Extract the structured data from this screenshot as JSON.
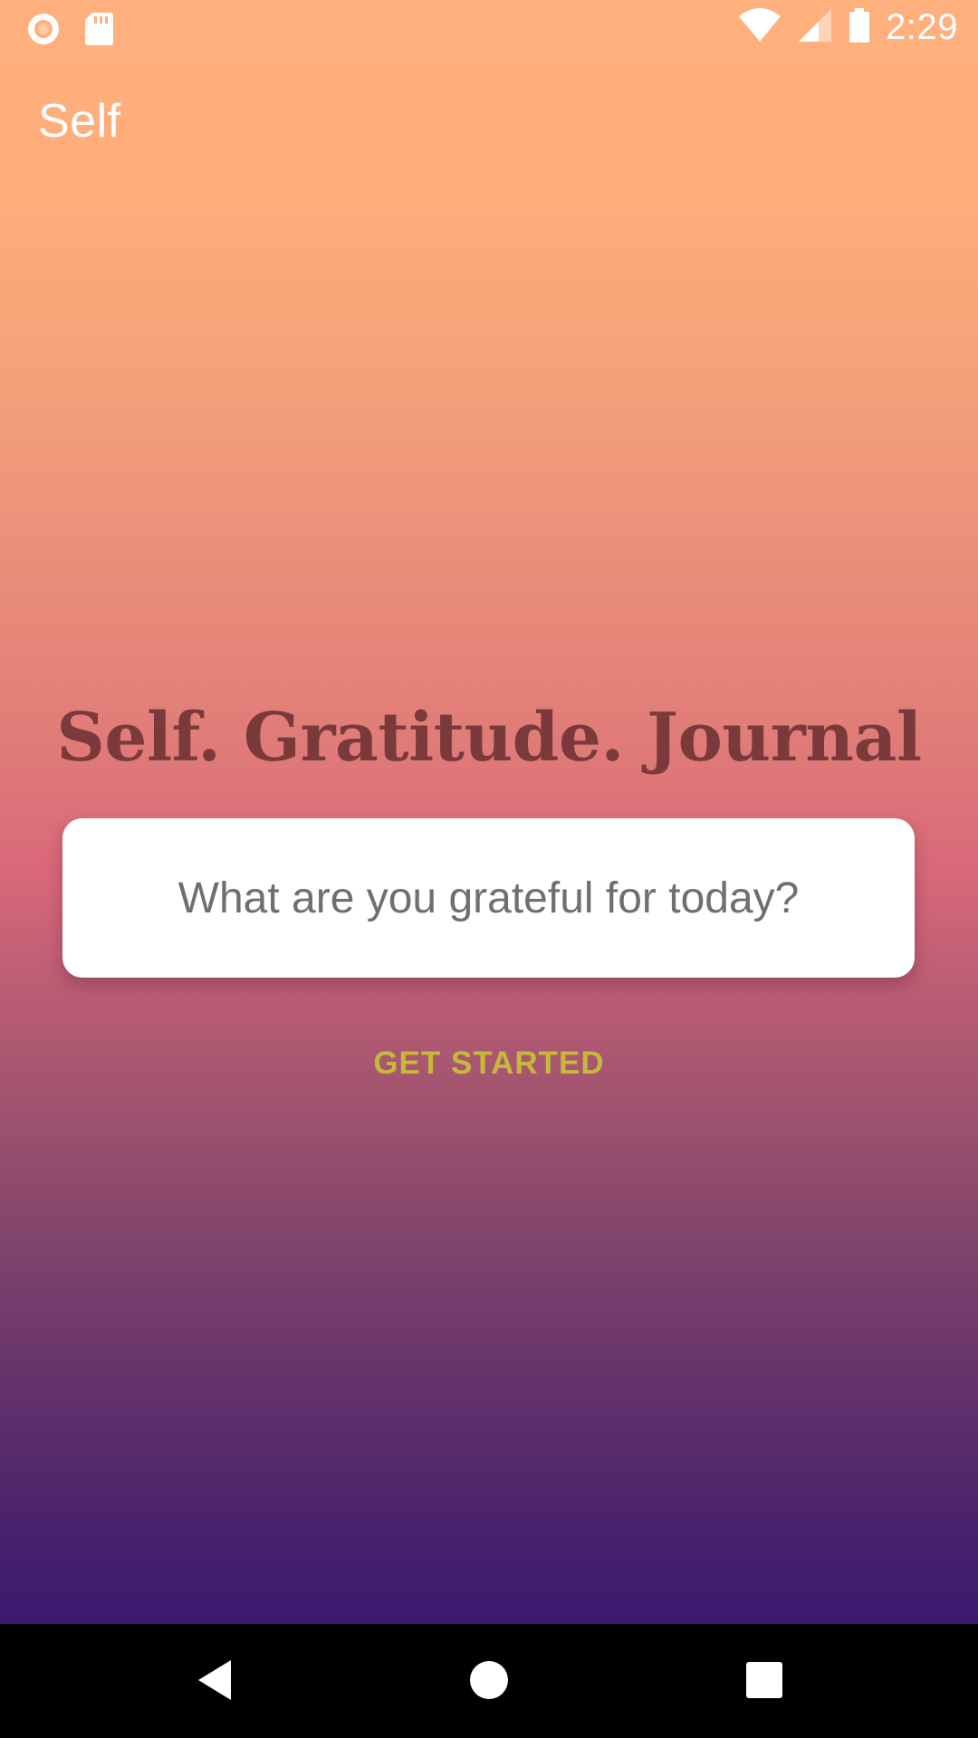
{
  "status_bar": {
    "time": "2:29",
    "left_icons": [
      "record-icon",
      "sd-card-icon"
    ],
    "right_icons": [
      "wifi-icon",
      "cell-signal-icon",
      "battery-icon"
    ]
  },
  "app_bar": {
    "title": "Self"
  },
  "main": {
    "headline": "Self. Gratitude. Journal",
    "prompt": "What are you grateful for today?",
    "cta_label": "GET STARTED"
  },
  "nav_bar": {
    "buttons": [
      "back-icon",
      "home-icon",
      "recents-icon"
    ]
  },
  "colors": {
    "gradient_top": "#ffb07c",
    "gradient_bottom": "#3b1a6f",
    "headline": "#7a3a3c",
    "cta": "#c5b93a",
    "prompt_text": "#6f6f6f"
  }
}
